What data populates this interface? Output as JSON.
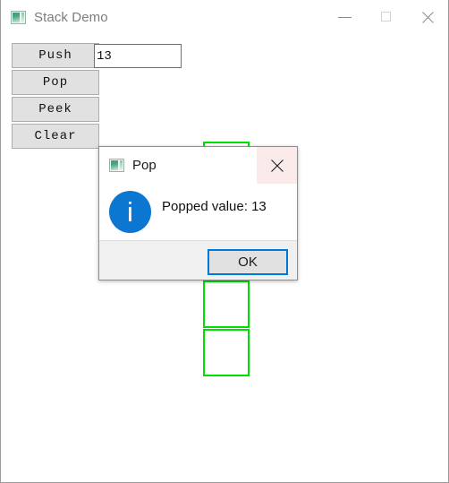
{
  "main_window": {
    "title": "Stack Demo",
    "icon": "app-window-icon",
    "caption": {
      "minimize": "minimize-icon",
      "maximize": "maximize-icon",
      "close": "close-icon"
    },
    "buttons": [
      {
        "label": "Push",
        "name": "push-button"
      },
      {
        "label": "Pop",
        "name": "pop-button"
      },
      {
        "label": "Peek",
        "name": "peek-button"
      },
      {
        "label": "Clear",
        "name": "clear-button"
      }
    ],
    "entry": {
      "value": "13",
      "placeholder": ""
    },
    "stack_canvas": {
      "cell_outline_color": "#00e000",
      "cells": [
        {
          "label": "",
          "occluded": true
        },
        {
          "label": "",
          "occluded": true
        },
        {
          "label": "",
          "occluded": false
        }
      ]
    }
  },
  "dialog": {
    "title": "Pop",
    "icon": "app-window-icon",
    "close_label": "✕",
    "info_glyph": "i",
    "message": "Popped value: 13",
    "ok_label": "OK",
    "accent_color": "#0078d7",
    "info_circle_color": "#0b77d0",
    "close_hover_color": "#fbeaea"
  }
}
